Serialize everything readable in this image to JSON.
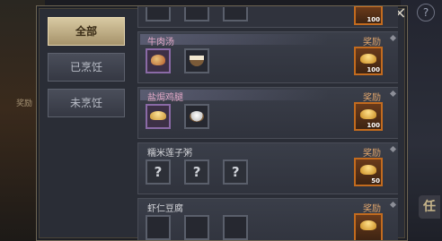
{
  "background": {
    "left_label": "奖励",
    "right_label": "任",
    "help_icon": "?"
  },
  "panel": {
    "close_label": "×"
  },
  "tabs": [
    {
      "label": "全部",
      "active": true
    },
    {
      "label": "已烹饪",
      "active": false
    },
    {
      "label": "未烹饪",
      "active": false
    }
  ],
  "rows": [
    {
      "title": "",
      "reward_label": "",
      "reward_qty": "100",
      "slots": [
        "",
        "",
        ""
      ]
    },
    {
      "title": "牛肉汤",
      "reward_label": "奖励",
      "reward_qty": "100",
      "slots": [
        "beef",
        "bowl"
      ]
    },
    {
      "title": "盐焗鸡腿",
      "reward_label": "奖励",
      "reward_qty": "100",
      "slots": [
        "gold-chicken",
        "salt"
      ]
    },
    {
      "title": "糯米莲子粥",
      "reward_label": "奖励",
      "reward_qty": "50",
      "slots": [
        "?",
        "?",
        "?"
      ]
    },
    {
      "title": "虾仁豆腐",
      "reward_label": "奖励",
      "reward_qty": "",
      "slots": [
        "",
        "",
        ""
      ]
    }
  ],
  "colors": {
    "title_pink": "#e4a9c7",
    "reward_orange": "#c36b1e",
    "tab_active": "#d8c9a2"
  }
}
